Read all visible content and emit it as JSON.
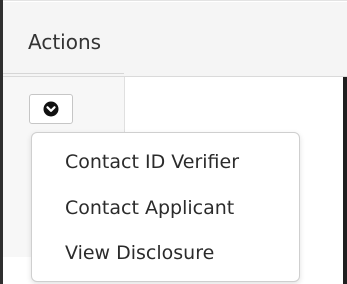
{
  "table": {
    "header": {
      "actions_label": "Actions"
    },
    "row": {
      "actions_toggle_icon": "chevron-down-circle-icon"
    }
  },
  "actions_menu": {
    "items": [
      {
        "label": "Contact ID Verifier"
      },
      {
        "label": "Contact Applicant"
      },
      {
        "label": "View Disclosure"
      }
    ]
  },
  "colors": {
    "text": "#2b2b2b",
    "header_bg": "#f5f5f5",
    "border": "#cfcfcf"
  }
}
